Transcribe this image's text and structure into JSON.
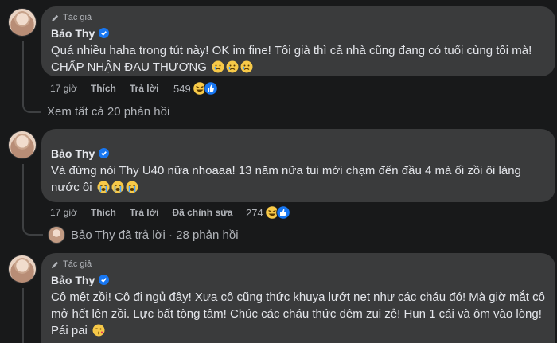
{
  "comments": [
    {
      "author_badge": "Tác giả",
      "name": "Bảo Thy",
      "text": "Quá nhiều haha trong tút này! OK im fine! Tôi già thì cả nhà cũng đang có tuổi cùng tôi mà! CHẤP NHẬN ĐAU THƯƠNG",
      "emoji_names": [
        "crying-face-icon",
        "crying-face-icon",
        "crying-face-icon"
      ],
      "time": "17 giờ",
      "like": "Thích",
      "reply": "Trả lời",
      "reaction_count": "549",
      "reaction_icons": [
        "haha-icon",
        "like-icon"
      ],
      "replies_link": "Xem tất cả 20 phản hồi"
    },
    {
      "author_badge": "",
      "name": "Bảo Thy",
      "text": "Và đừng nói Thy U40 nữa nhoaaa! 13 năm nữa tui mới chạm đến đầu 4 mà ối zồi ôi làng nước ôi",
      "emoji_names": [
        "loudly-crying-icon",
        "loudly-crying-icon",
        "loudly-crying-icon"
      ],
      "time": "17 giờ",
      "like": "Thích",
      "reply": "Trả lời",
      "edited": "Đã chỉnh sửa",
      "reaction_count": "274",
      "reaction_icons": [
        "haha-icon",
        "like-icon"
      ],
      "replies_link": "Bảo Thy đã trả lời · 28 phản hồi"
    },
    {
      "author_badge": "Tác giả",
      "name": "Bảo Thy",
      "text": "Cô mệt zồi! Cô đi ngủ đây! Xưa cô cũng thức khuya lướt net như các cháu đó! Mà giờ mắt cô mở hết lên zồi. Lực bất tòng tâm! Chúc các cháu thức đêm zui zẻ! Hun 1 cái và ôm vào lòng! Pái pai",
      "emoji_names": [
        "kissing-face-icon"
      ],
      "time": "",
      "like": "",
      "reply": ""
    }
  ],
  "colors": {
    "background": "#18191a",
    "bubble": "#3a3b3c",
    "text": "#e4e6eb",
    "muted": "#b0b3b8",
    "verified": "#1877f2"
  }
}
